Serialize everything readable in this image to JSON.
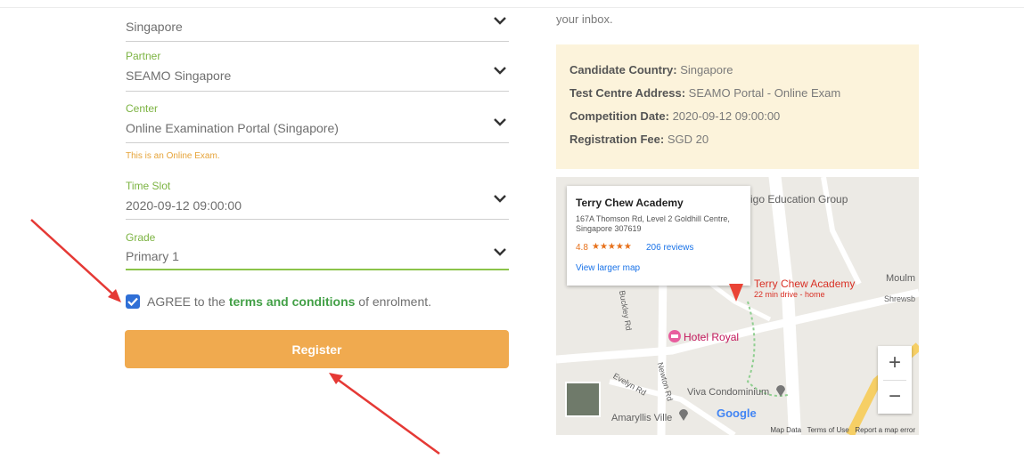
{
  "form": {
    "country": {
      "value": "Singapore"
    },
    "partner": {
      "label": "Partner",
      "value": "SEAMO Singapore"
    },
    "center": {
      "label": "Center",
      "value": "Online Examination Portal (Singapore)"
    },
    "online_note": "This is an Online Exam.",
    "time_slot": {
      "label": "Time Slot",
      "value": "2020-09-12 09:00:00"
    },
    "grade": {
      "label": "Grade",
      "value": "Primary 1"
    },
    "agree": {
      "checked": true,
      "prefix": "AGREE to the",
      "link": "terms and conditions",
      "suffix": "of enrolment."
    },
    "register_label": "Register"
  },
  "info": {
    "inbox_text": "your inbox.",
    "country_label": "Candidate Country:",
    "country_value": "Singapore",
    "address_label": "Test Centre Address:",
    "address_value": "SEAMO Portal - Online Exam",
    "date_label": "Competition Date:",
    "date_value": "2020-09-12 09:00:00",
    "fee_label": "Registration Fee:",
    "fee_value": "SGD 20"
  },
  "map": {
    "card": {
      "name": "Terry Chew Academy",
      "address": "167A Thomson Rd, Level 2 Goldhill Centre, Singapore 307619",
      "rating": "4.8",
      "stars": "★★★★★",
      "reviews": "206 reviews",
      "larger_map": "View larger map"
    },
    "labels": {
      "education_group": "igo Education Group",
      "pin_name": "Terry Chew Academy",
      "pin_sub": "22 min drive - home",
      "hotel": "Hotel Royal",
      "viva": "Viva Condominium",
      "amaryllis": "Amaryllis Ville",
      "newton": "Newton Rd",
      "buckley": "Buckley Rd",
      "evelyn": "Evelyn Rd",
      "moulmein": "Moulm",
      "shrewsbury": "Shrewsb",
      "google": "Google"
    },
    "zoom_in": "+",
    "zoom_out": "−",
    "footer": {
      "map_data": "Map Data",
      "terms": "Terms of Use",
      "report": "Report a map error"
    }
  },
  "colors": {
    "accent_green": "#8bc34a",
    "register_orange": "#f0aa4f",
    "info_bg": "#fcf3db",
    "annotation_red": "#e53935"
  }
}
